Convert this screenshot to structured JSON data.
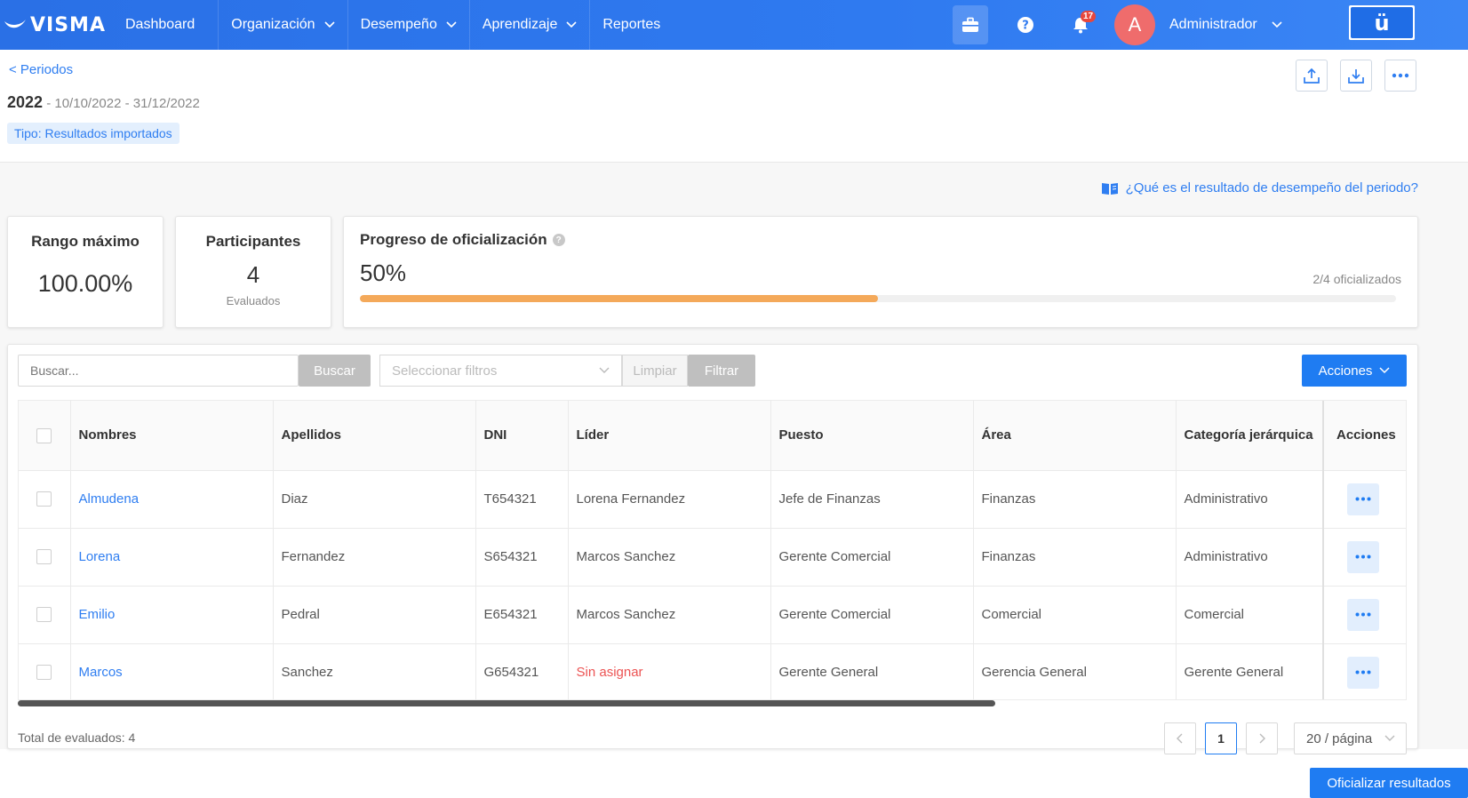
{
  "nav": {
    "logo": "VISMA",
    "items": [
      {
        "label": "Dashboard",
        "has_dropdown": false
      },
      {
        "label": "Organización",
        "has_dropdown": true
      },
      {
        "label": "Desempeño",
        "has_dropdown": true
      },
      {
        "label": "Aprendizaje",
        "has_dropdown": true
      },
      {
        "label": "Reportes",
        "has_dropdown": false
      }
    ],
    "notification_count": "17",
    "avatar_initial": "A",
    "user_name": "Administrador",
    "brand_button_label": "ü"
  },
  "header": {
    "back_link": "< Periodos",
    "year": "2022",
    "date_range": " - 10/10/2022 - 31/12/2022",
    "type_tag": "Tipo: Resultados importados"
  },
  "help_link": "¿Qué es el resultado de desempeño del periodo?",
  "stats": {
    "max_range": {
      "label": "Rango máximo",
      "value": "100.00%"
    },
    "participants": {
      "label": "Participantes",
      "value": "4",
      "sub": "Evaluados"
    },
    "progress": {
      "label": "Progreso de oficialización",
      "percent_label": "50%",
      "count_label": "2/4 oficializados",
      "fraction": 0.5
    }
  },
  "filters": {
    "search_placeholder": "Buscar...",
    "search_button": "Buscar",
    "filter_placeholder": "Seleccionar filtros",
    "clear_button": "Limpiar",
    "filter_button": "Filtrar",
    "actions_button": "Acciones"
  },
  "table": {
    "columns": [
      "Nombres",
      "Apellidos",
      "DNI",
      "Líder",
      "Puesto",
      "Área",
      "Categoría jerárquica",
      "Acciones"
    ],
    "rows": [
      {
        "nombre": "Almudena",
        "apellido": "Diaz",
        "dni": "T654321",
        "lider": "Lorena Fernandez",
        "puesto": "Jefe de Finanzas",
        "area": "Finanzas",
        "categoria": "Administrativo"
      },
      {
        "nombre": "Lorena",
        "apellido": "Fernandez",
        "dni": "S654321",
        "lider": "Marcos Sanchez",
        "puesto": "Gerente Comercial",
        "area": "Finanzas",
        "categoria": "Administrativo"
      },
      {
        "nombre": "Emilio",
        "apellido": "Pedral",
        "dni": "E654321",
        "lider": "Marcos Sanchez",
        "puesto": "Gerente Comercial",
        "area": "Comercial",
        "categoria": "Comercial"
      },
      {
        "nombre": "Marcos",
        "apellido": "Sanchez",
        "dni": "G654321",
        "lider": "Sin asignar",
        "lider_unassigned": true,
        "puesto": "Gerente General",
        "area": "Gerencia General",
        "categoria": "Gerente General"
      }
    ]
  },
  "footer": {
    "total": "Total de evaluados: 4",
    "current_page": "1",
    "per_page": "20 / página",
    "officialize_button": "Oficializar resultados"
  },
  "colors": {
    "nav_bg": "#2f7af0",
    "link": "#2f7ef1",
    "primary_button": "#1f7cf2",
    "progress_fill": "#f4a95a",
    "unassigned_text": "#ec5353",
    "avatar_bg": "#ef6c6c"
  },
  "icons": {
    "briefcase": "briefcase-icon",
    "help": "help-circle-icon",
    "bell": "bell-icon",
    "upload": "upload-icon",
    "download": "download-icon",
    "more": "more-dots-icon",
    "book": "book-icon",
    "chevron": "chevron-down-icon"
  }
}
